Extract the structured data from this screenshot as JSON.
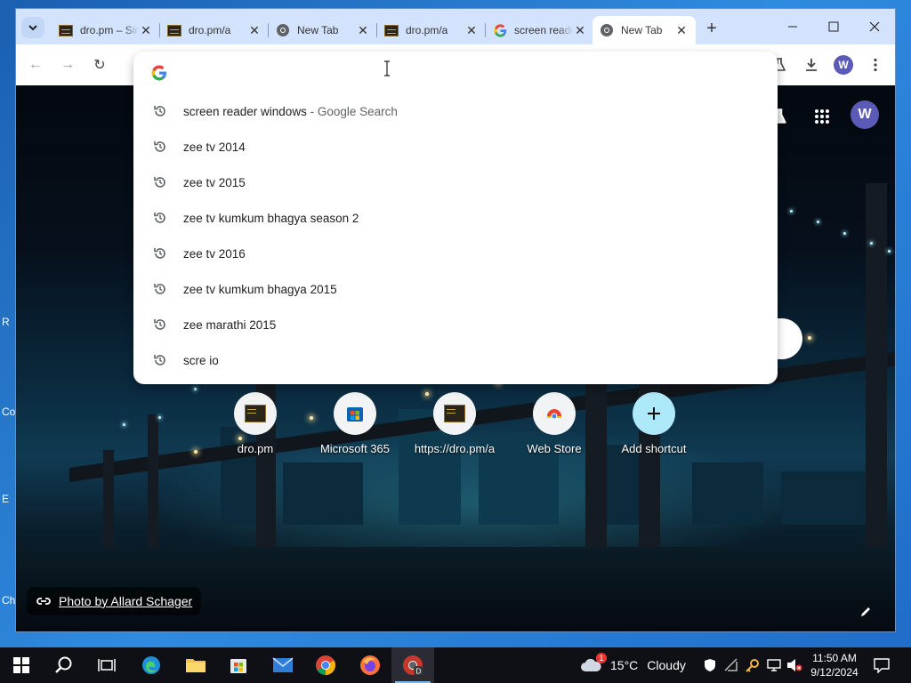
{
  "desktop": {
    "labels": [
      "R",
      "Co",
      "E",
      "Ch"
    ]
  },
  "browser": {
    "tabs": [
      {
        "title": "dro.pm – Simple Link Shortener",
        "favicon": "dro-favicon",
        "active": false
      },
      {
        "title": "dro.pm/a",
        "favicon": "dro-favicon",
        "active": false
      },
      {
        "title": "New Tab",
        "favicon": "chrome-icon",
        "active": false
      },
      {
        "title": "dro.pm/a",
        "favicon": "dro-favicon",
        "active": false
      },
      {
        "title": "screen reader windows",
        "favicon": "google-icon",
        "active": false
      },
      {
        "title": "New Tab",
        "favicon": "chrome-icon",
        "active": true
      }
    ],
    "new_tab_symbol": "+",
    "window_controls": {
      "minimize": "—",
      "maximize": "☐",
      "close": "✕"
    },
    "toolbar": {
      "back": "←",
      "forward": "→",
      "reload": "↻"
    },
    "profile_initial": "W"
  },
  "omnibox": {
    "query": "",
    "suggestions": [
      {
        "text": "screen reader windows",
        "desc": " - Google Search"
      },
      {
        "text": "zee tv 2014",
        "desc": ""
      },
      {
        "text": "zee tv 2015",
        "desc": ""
      },
      {
        "text": "zee tv kumkum bhagya season 2",
        "desc": ""
      },
      {
        "text": "zee tv 2016",
        "desc": ""
      },
      {
        "text": "zee tv kumkum bhagya 2015",
        "desc": ""
      },
      {
        "text": "zee marathi 2015",
        "desc": ""
      },
      {
        "text": "scre io",
        "desc": ""
      }
    ]
  },
  "ntp": {
    "profile_initial": "W",
    "shortcuts": [
      {
        "label": "dro.pm",
        "icon": "dro-favicon"
      },
      {
        "label": "Microsoft 365",
        "icon": "microsoft-store-icon"
      },
      {
        "label": "https://dro.pm/a",
        "icon": "dro-favicon"
      },
      {
        "label": "Web Store",
        "icon": "chrome-web-store-icon"
      },
      {
        "label": "Add shortcut",
        "icon": "plus-icon"
      }
    ],
    "attribution": "Photo by Allard Schager"
  },
  "taskbar": {
    "weather": {
      "temp": "15°C",
      "condition": "Cloudy",
      "badge": "1"
    },
    "clock": {
      "time": "11:50 AM",
      "date": "9/12/2024"
    }
  }
}
